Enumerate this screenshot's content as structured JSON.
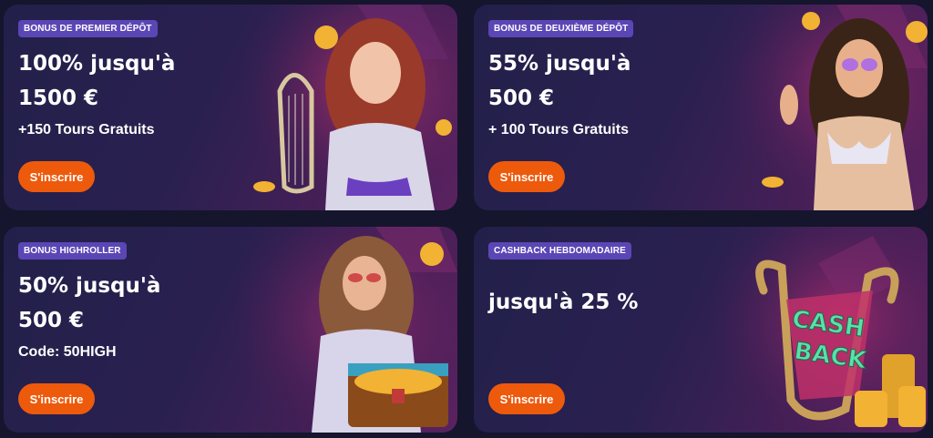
{
  "cards": [
    {
      "badge": "BONUS DE PREMIER DÉPÔT",
      "title_line1": "100% jusqu'à",
      "title_line2": "1500 €",
      "subtitle": "+150 Tours Gratuits",
      "button": "S'inscrire"
    },
    {
      "badge": "BONUS DE DEUXIÈME DÉPÔT",
      "title_line1": "55% jusqu'à",
      "title_line2": "500 €",
      "subtitle": "+ 100 Tours Gratuits",
      "button": "S'inscrire"
    },
    {
      "badge": "BONUS HIGHROLLER",
      "title_line1": "50% jusqu'à",
      "title_line2": "500 €",
      "subtitle": "Code: 50HIGH",
      "button": "S'inscrire"
    },
    {
      "badge": "CASHBACK HEBDOMADAIRE",
      "title_line1": "jusqu'à 25 %",
      "button": "S'inscrire",
      "art_text_1": "CASH",
      "art_text_2": "BACK"
    }
  ],
  "colors": {
    "badge": "#5b46b5",
    "button": "#ee5a0c",
    "background": "#15152d",
    "coin": "#f2b233"
  },
  "icons": [
    "goddess-harp-illustration",
    "goddess-sunglasses-illustration",
    "goddess-treasure-chest-illustration",
    "cashback-harp-illustration",
    "gold-coin-icon"
  ]
}
